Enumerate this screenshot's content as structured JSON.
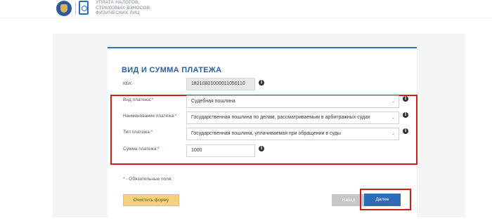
{
  "header": {
    "title_line1": "УПЛАТА НАЛОГОВ,",
    "title_line2": "СТРАХОВЫХ ВЗНОСОВ",
    "title_line3": "ФИЗИЧЕСКИХ ЛИЦ"
  },
  "form": {
    "title": "ВИД И СУММА ПЛАТЕЖА",
    "kbk": {
      "label": "КБК:",
      "value": "18210801000011050110"
    },
    "payment_kind": {
      "label": "Вид платежа:",
      "required": "*",
      "value": "Судебная пошлина"
    },
    "payment_name": {
      "label": "Наименование платежа:",
      "required": "*",
      "value": "Государственная пошлина по делам, рассматриваемым в арбитражных судах"
    },
    "payment_type": {
      "label": "Тип платежа:",
      "required": "*",
      "value": "Государственная пошлина, уплачиваемая при обращении в суды"
    },
    "amount": {
      "label": "Сумма платежа:",
      "required": "*",
      "value": "1000"
    },
    "required_note": "* - Обязательные поля."
  },
  "buttons": {
    "clear": "Очистить форму",
    "back": "Назад",
    "next": "Далее"
  },
  "icons": {
    "info": "i",
    "chevron": "⌄"
  },
  "colors": {
    "accent": "#2e73b8",
    "highlight": "#c9201d",
    "clear_button": "#f0d37a"
  }
}
